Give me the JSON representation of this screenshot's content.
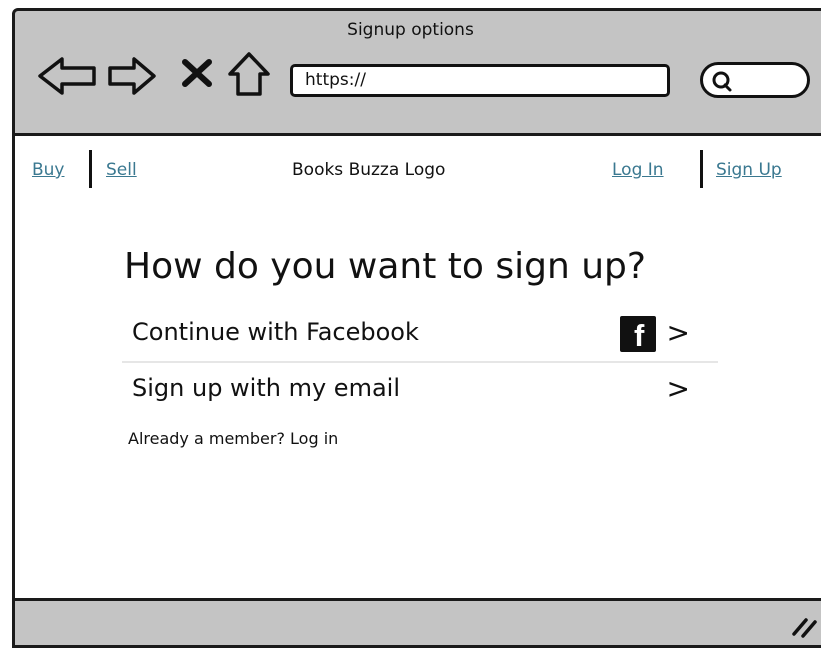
{
  "window": {
    "title": "Signup options"
  },
  "toolbar": {
    "url_value": "https://",
    "icons": [
      "back-arrow-icon",
      "forward-arrow-icon",
      "close-icon",
      "home-icon",
      "search-icon"
    ]
  },
  "nav": {
    "buy": "Buy",
    "sell": "Sell",
    "logo": "Books Buzza Logo",
    "login": "Log In",
    "signup": "Sign Up",
    "link_color": "#3a7890"
  },
  "signup": {
    "heading": "How do you want to sign up?",
    "options": [
      {
        "label": "Continue with Facebook",
        "icon": "facebook-icon",
        "chevron": ">"
      },
      {
        "label": "Sign up with my email",
        "chevron": ">"
      }
    ],
    "facebook_glyph": "f",
    "member_text": "Already a member? Log in"
  },
  "colors": {
    "chrome": "#c4c4c4",
    "border": "#1a1a1a",
    "background": "#ffffff"
  }
}
